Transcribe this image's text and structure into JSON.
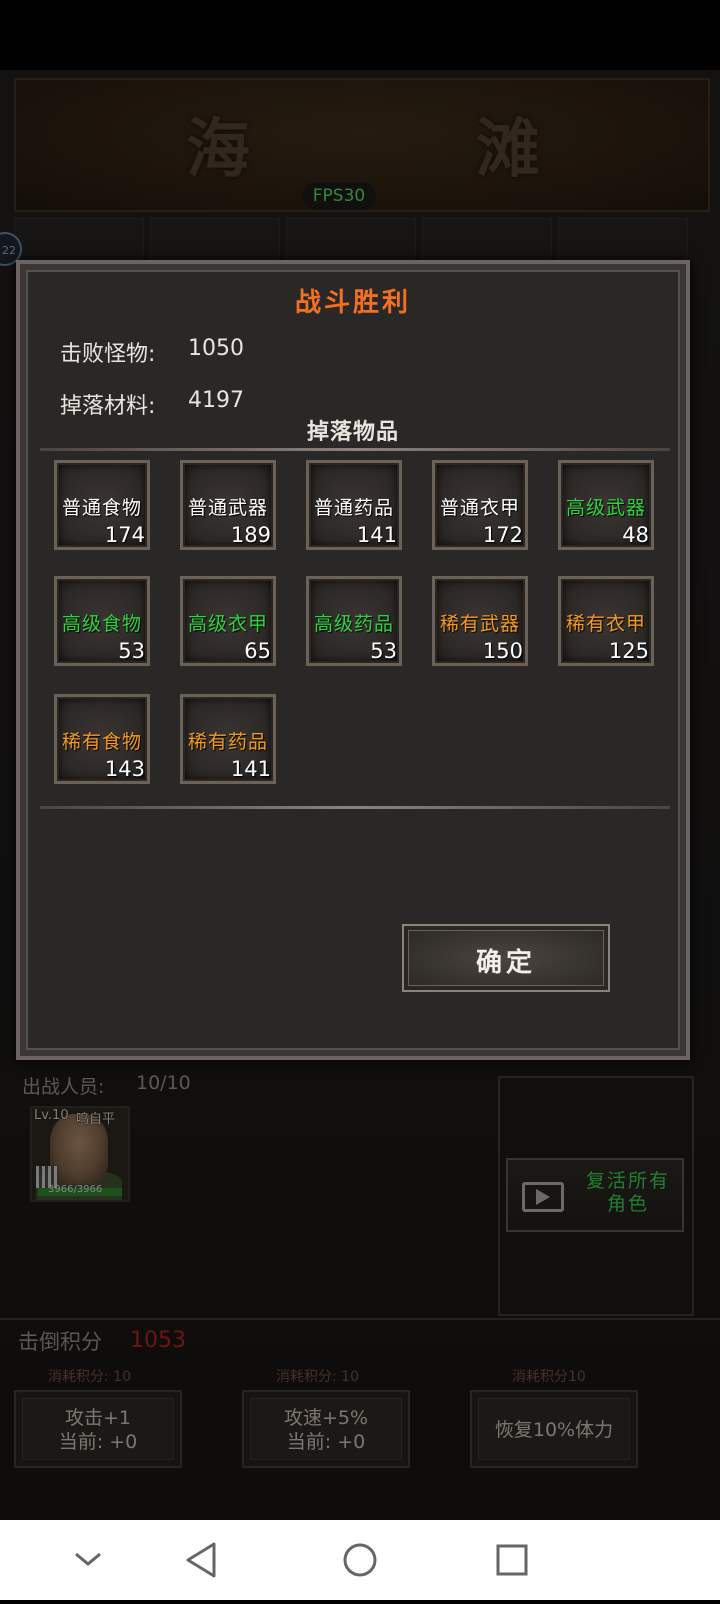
{
  "banner": {
    "left_char": "海",
    "right_char": "滩",
    "fps": "FPS30"
  },
  "side_badge": "22",
  "dialog": {
    "title": "战斗胜利",
    "defeated_label": "击败怪物:",
    "defeated_value": "1050",
    "materials_label": "掉落材料:",
    "materials_value": "4197",
    "drops_title": "掉落物品",
    "items": [
      {
        "name": "普通食物",
        "count": "174",
        "color": "#ffffff"
      },
      {
        "name": "普通武器",
        "count": "189",
        "color": "#ffffff"
      },
      {
        "name": "普通药品",
        "count": "141",
        "color": "#ffffff"
      },
      {
        "name": "普通衣甲",
        "count": "172",
        "color": "#ffffff"
      },
      {
        "name": "高级武器",
        "count": "48",
        "color": "#2fd33f"
      },
      {
        "name": "高级食物",
        "count": "53",
        "color": "#2fd33f"
      },
      {
        "name": "高级衣甲",
        "count": "65",
        "color": "#2fd33f"
      },
      {
        "name": "高级药品",
        "count": "53",
        "color": "#2fd33f"
      },
      {
        "name": "稀有武器",
        "count": "150",
        "color": "#f39a25"
      },
      {
        "name": "稀有衣甲",
        "count": "125",
        "color": "#f39a25"
      },
      {
        "name": "稀有食物",
        "count": "143",
        "color": "#f39a25"
      },
      {
        "name": "稀有药品",
        "count": "141",
        "color": "#f39a25"
      }
    ],
    "confirm": "确定"
  },
  "team": {
    "label": "出战人员:",
    "count": "10/10",
    "hero": {
      "level": "Lv.10",
      "name": "鸣自平",
      "hp": "3966/3966"
    }
  },
  "revive": {
    "label": "复活所有角色"
  },
  "score": {
    "label": "击倒积分",
    "value": "1053"
  },
  "buffs": [
    {
      "cost": "消耗积分: 10",
      "line1": "攻击+1",
      "line2": "当前: +0"
    },
    {
      "cost": "消耗积分: 10",
      "line1": "攻速+5%",
      "line2": "当前: +0"
    },
    {
      "cost": "消耗积分10",
      "line1": "恢复10%体力",
      "line2": ""
    }
  ],
  "navbar": [
    "back-chevron-icon",
    "back-triangle-icon",
    "home-circle-icon",
    "recents-square-icon"
  ]
}
